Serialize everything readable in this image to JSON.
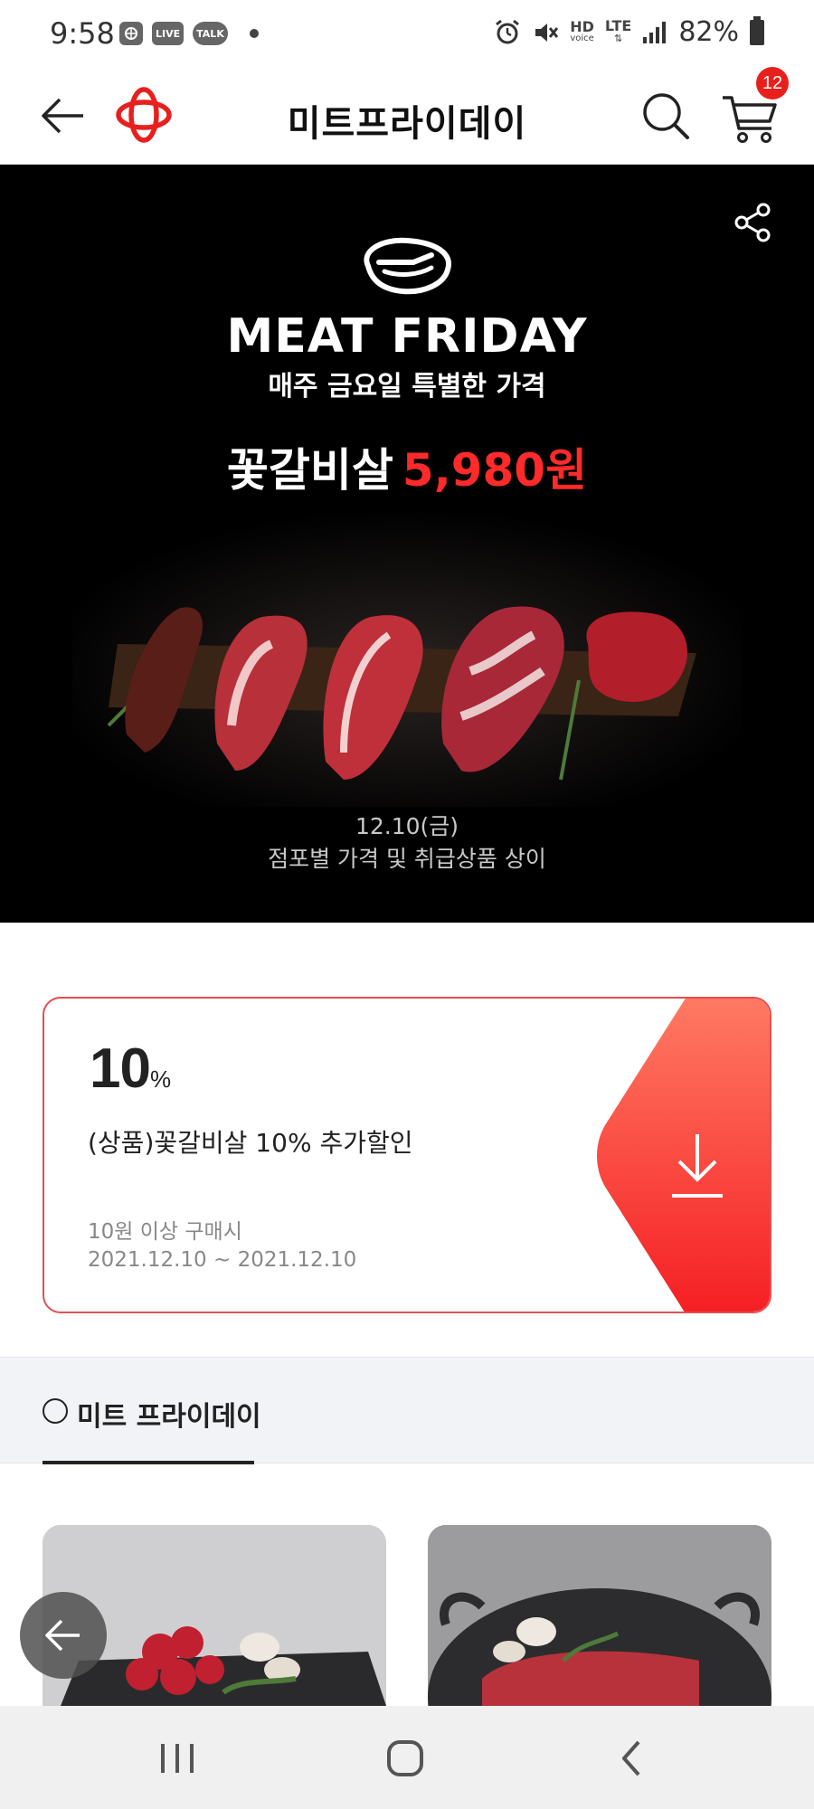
{
  "status_bar": {
    "time": "9:58",
    "chip_live": "LIVE",
    "chip_talk": "TALK",
    "hd_label": "HD",
    "voice_label": "voice",
    "lte_label": "LTE",
    "battery": "82%"
  },
  "header": {
    "title": "미트프라이데이",
    "cart_count": "12",
    "brand_color": "#e8201d"
  },
  "banner": {
    "heading": "MEAT FRIDAY",
    "subheading": "매주 금요일 특별한 가격",
    "product_name": "꽃갈비살",
    "product_price": "5,980원",
    "date": "12.10(금)",
    "note": "점포별 가격 및 취급상품 상이",
    "accent_color": "#ff2a2a"
  },
  "coupon": {
    "percent_value": "10",
    "percent_unit": "%",
    "title": "(상품)꽃갈비살 10% 추가할인",
    "condition": "10원 이상 구매시",
    "period": "2021.12.10 ~ 2021.12.10",
    "download_icon": "download-icon"
  },
  "tabs": {
    "active_label": "미트 프라이데이"
  },
  "icons": {
    "back": "arrow-left-icon",
    "search": "search-icon",
    "cart": "cart-icon",
    "share": "share-icon",
    "nav_recent": "recent-apps-icon",
    "nav_home": "home-icon",
    "nav_back": "chevron-left-icon"
  }
}
